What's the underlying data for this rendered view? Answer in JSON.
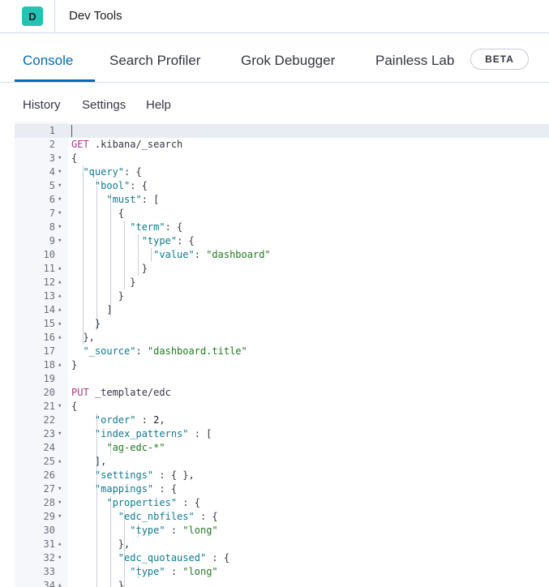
{
  "header": {
    "app_badge": "D",
    "title": "Dev Tools"
  },
  "tabs": [
    {
      "label": "Console",
      "selected": true
    },
    {
      "label": "Search Profiler",
      "selected": false
    },
    {
      "label": "Grok Debugger",
      "selected": false
    },
    {
      "label": "Painless Lab",
      "selected": false,
      "badge": "BETA"
    }
  ],
  "menu": {
    "history": "History",
    "settings": "Settings",
    "help": "Help"
  },
  "editor": {
    "lines": [
      {
        "n": "1",
        "fold": "",
        "t": []
      },
      {
        "n": "2",
        "fold": "",
        "t": [
          [
            "m",
            "GET"
          ],
          [
            "p",
            " .kibana/_search"
          ]
        ]
      },
      {
        "n": "3",
        "fold": "▾",
        "t": [
          [
            "p",
            "{"
          ]
        ]
      },
      {
        "n": "4",
        "fold": "▾",
        "t": [
          [
            "p",
            "  "
          ],
          [
            "k",
            "\"query\""
          ],
          [
            "p",
            ": {"
          ]
        ]
      },
      {
        "n": "5",
        "fold": "▾",
        "t": [
          [
            "p",
            "    "
          ],
          [
            "k",
            "\"bool\""
          ],
          [
            "p",
            ": {"
          ]
        ]
      },
      {
        "n": "6",
        "fold": "▾",
        "t": [
          [
            "p",
            "      "
          ],
          [
            "k",
            "\"must\""
          ],
          [
            "p",
            ": ["
          ]
        ]
      },
      {
        "n": "7",
        "fold": "▾",
        "t": [
          [
            "p",
            "        {"
          ]
        ]
      },
      {
        "n": "8",
        "fold": "▾",
        "t": [
          [
            "p",
            "          "
          ],
          [
            "k",
            "\"term\""
          ],
          [
            "p",
            ": {"
          ]
        ]
      },
      {
        "n": "9",
        "fold": "▾",
        "t": [
          [
            "p",
            "            "
          ],
          [
            "k",
            "\"type\""
          ],
          [
            "p",
            ": {"
          ]
        ]
      },
      {
        "n": "10",
        "fold": "",
        "t": [
          [
            "p",
            "              "
          ],
          [
            "k",
            "\"value\""
          ],
          [
            "p",
            ": "
          ],
          [
            "s",
            "\"dashboard\""
          ]
        ]
      },
      {
        "n": "11",
        "fold": "▴",
        "t": [
          [
            "p",
            "            }"
          ]
        ]
      },
      {
        "n": "12",
        "fold": "▴",
        "t": [
          [
            "p",
            "          }"
          ]
        ]
      },
      {
        "n": "13",
        "fold": "▴",
        "t": [
          [
            "p",
            "        }"
          ]
        ]
      },
      {
        "n": "14",
        "fold": "▴",
        "t": [
          [
            "p",
            "      ]"
          ]
        ]
      },
      {
        "n": "15",
        "fold": "▴",
        "t": [
          [
            "p",
            "    }"
          ]
        ]
      },
      {
        "n": "16",
        "fold": "▴",
        "t": [
          [
            "p",
            "  },"
          ]
        ]
      },
      {
        "n": "17",
        "fold": "",
        "t": [
          [
            "p",
            "  "
          ],
          [
            "k",
            "\"_source\""
          ],
          [
            "p",
            ": "
          ],
          [
            "s",
            "\"dashboard.title\""
          ]
        ]
      },
      {
        "n": "18",
        "fold": "▴",
        "t": [
          [
            "p",
            "}"
          ]
        ]
      },
      {
        "n": "19",
        "fold": "",
        "t": []
      },
      {
        "n": "20",
        "fold": "",
        "t": [
          [
            "m",
            "PUT"
          ],
          [
            "p",
            " _template/edc"
          ]
        ]
      },
      {
        "n": "21",
        "fold": "▾",
        "t": [
          [
            "p",
            "{"
          ]
        ]
      },
      {
        "n": "22",
        "fold": "",
        "t": [
          [
            "p",
            "    "
          ],
          [
            "k",
            "\"order\""
          ],
          [
            "p",
            " : "
          ],
          [
            "n",
            "2"
          ],
          [
            "p",
            ","
          ]
        ]
      },
      {
        "n": "23",
        "fold": "▾",
        "t": [
          [
            "p",
            "    "
          ],
          [
            "k",
            "\"index_patterns\""
          ],
          [
            "p",
            " : ["
          ]
        ]
      },
      {
        "n": "24",
        "fold": "",
        "t": [
          [
            "p",
            "      "
          ],
          [
            "s",
            "\"ag-edc-*\""
          ]
        ]
      },
      {
        "n": "25",
        "fold": "▴",
        "t": [
          [
            "p",
            "    ],"
          ]
        ]
      },
      {
        "n": "26",
        "fold": "",
        "t": [
          [
            "p",
            "    "
          ],
          [
            "k",
            "\"settings\""
          ],
          [
            "p",
            " : { },"
          ]
        ]
      },
      {
        "n": "27",
        "fold": "▾",
        "t": [
          [
            "p",
            "    "
          ],
          [
            "k",
            "\"mappings\""
          ],
          [
            "p",
            " : {"
          ]
        ]
      },
      {
        "n": "28",
        "fold": "▾",
        "t": [
          [
            "p",
            "      "
          ],
          [
            "k",
            "\"properties\""
          ],
          [
            "p",
            " : {"
          ]
        ]
      },
      {
        "n": "29",
        "fold": "▾",
        "t": [
          [
            "p",
            "        "
          ],
          [
            "k",
            "\"edc_nbfiles\""
          ],
          [
            "p",
            " : {"
          ]
        ]
      },
      {
        "n": "30",
        "fold": "",
        "t": [
          [
            "p",
            "          "
          ],
          [
            "k",
            "\"type\""
          ],
          [
            "p",
            " : "
          ],
          [
            "s",
            "\"long\""
          ]
        ]
      },
      {
        "n": "31",
        "fold": "▴",
        "t": [
          [
            "p",
            "        },"
          ]
        ]
      },
      {
        "n": "32",
        "fold": "▾",
        "t": [
          [
            "p",
            "        "
          ],
          [
            "k",
            "\"edc_quotaused\""
          ],
          [
            "p",
            " : {"
          ]
        ]
      },
      {
        "n": "33",
        "fold": "",
        "t": [
          [
            "p",
            "          "
          ],
          [
            "k",
            "\"type\""
          ],
          [
            "p",
            " : "
          ],
          [
            "s",
            "\"long\""
          ]
        ]
      },
      {
        "n": "34",
        "fold": "▴",
        "t": [
          [
            "p",
            "        },"
          ]
        ]
      }
    ]
  }
}
